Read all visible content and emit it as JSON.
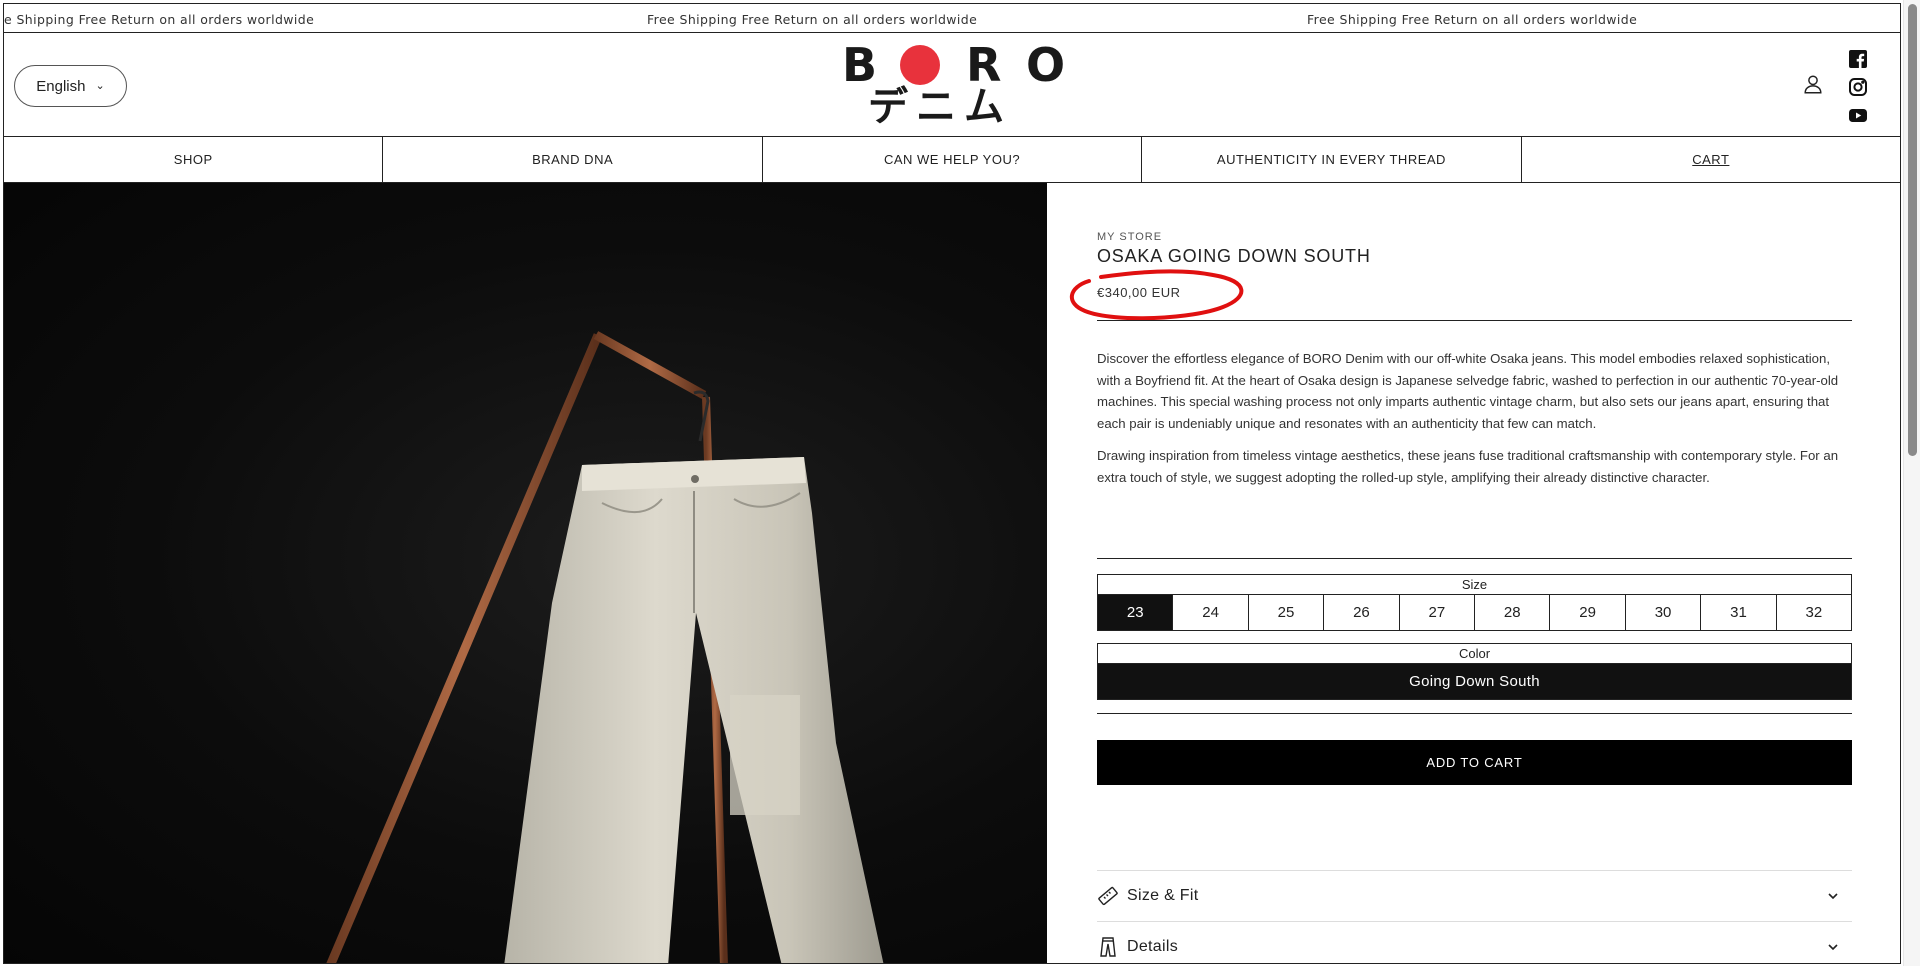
{
  "announcement": {
    "messages": [
      "e Shipping Free Return on all orders worldwide",
      "Free Shipping Free Return on all orders worldwide",
      "Free Shipping Free Return on all orders worldwide"
    ]
  },
  "header": {
    "language": "English",
    "logo": {
      "letters": [
        "B",
        "R",
        "O"
      ],
      "katakana": "デニム",
      "dot_color": "#e8323c"
    },
    "icons": [
      "account-icon",
      "facebook-icon",
      "instagram-icon",
      "youtube-icon"
    ]
  },
  "nav": {
    "items": [
      "SHOP",
      "BRAND DNA",
      "CAN WE HELP YOU?",
      "AUTHENTICITY IN EVERY THREAD",
      "CART"
    ]
  },
  "product": {
    "vendor": "MY STORE",
    "title": "OSAKA GOING DOWN SOUTH",
    "price": "€340,00 EUR",
    "description": [
      "Discover the effortless elegance of BORO Denim with our off-white Osaka jeans. This model embodies relaxed sophistication, with a Boyfriend fit. At the heart of Osaka design is Japanese selvedge fabric, washed to perfection in our authentic 70-year-old machines. This special washing process not only imparts authentic vintage charm, but also sets our jeans apart, ensuring that each pair is undeniably unique and resonates with an authenticity that few can match.",
      "Drawing inspiration from timeless vintage aesthetics, these jeans fuse traditional craftsmanship with contemporary style. For an extra touch of style, we suggest adopting the rolled-up style, amplifying their already distinctive character."
    ],
    "size": {
      "label": "Size",
      "options": [
        "23",
        "24",
        "25",
        "26",
        "27",
        "28",
        "29",
        "30",
        "31",
        "32"
      ],
      "selected": "23"
    },
    "color": {
      "label": "Color",
      "value": "Going Down South"
    },
    "add_to_cart": "ADD TO CART",
    "accordions": [
      {
        "label": "Size & Fit",
        "icon": "ruler-icon"
      },
      {
        "label": "Details",
        "icon": "pants-icon"
      }
    ],
    "annotation_color": "#e01010"
  }
}
